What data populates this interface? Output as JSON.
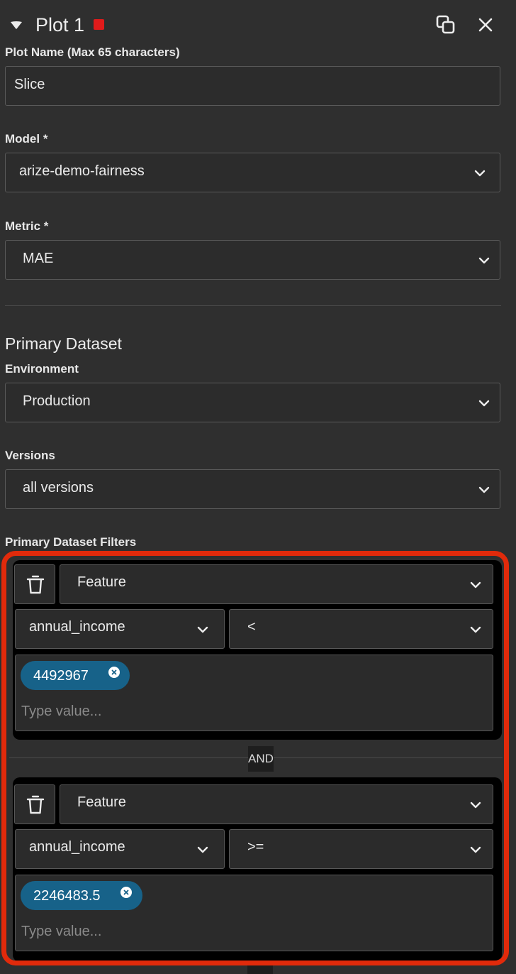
{
  "header": {
    "title": "Plot 1",
    "status_color": "#e11b1b",
    "collapse_icon": "caret-down-icon",
    "copy_icon": "duplicate-icon",
    "close_icon": "close-icon"
  },
  "plot_name": {
    "label": "Plot Name (Max 65 characters)",
    "value": "Slice"
  },
  "model": {
    "label": "Model *",
    "value": "arize-demo-fairness"
  },
  "metric": {
    "label": "Metric *",
    "value": "MAE"
  },
  "primary_dataset": {
    "title": "Primary Dataset",
    "environment": {
      "label": "Environment",
      "value": "Production"
    },
    "versions": {
      "label": "Versions",
      "value": "all versions"
    }
  },
  "filters": {
    "label": "Primary Dataset Filters",
    "conjunction": "AND",
    "items": [
      {
        "type": "Feature",
        "feature": "annual_income",
        "operator": "<",
        "tags": [
          "4492967"
        ],
        "placeholder": "Type value..."
      },
      {
        "type": "Feature",
        "feature": "annual_income",
        "operator": ">=",
        "tags": [
          "2246483.5"
        ],
        "placeholder": "Type value..."
      }
    ]
  },
  "colors": {
    "background": "#2f2f2f",
    "highlight": "#e12a0b",
    "tag": "#176289"
  }
}
